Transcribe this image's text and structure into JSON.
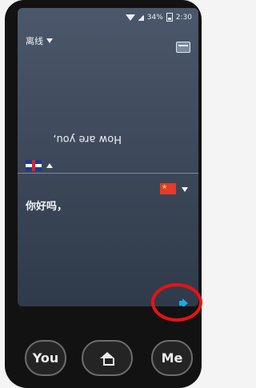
{
  "status": {
    "battery": "34%",
    "time": "2:30"
  },
  "header": {
    "mode_label": "离线"
  },
  "translation": {
    "upper_text": "How are you,",
    "lower_text": "你好吗，"
  },
  "buttons": {
    "you_label": "You",
    "me_label": "Me"
  },
  "colors": {
    "accent": "#1ea7e1",
    "highlight": "#ea1212"
  },
  "icons": [
    "wifi-icon",
    "signal-icon",
    "battery-icon",
    "keyboard-icon",
    "speaker-icon",
    "home-icon"
  ]
}
